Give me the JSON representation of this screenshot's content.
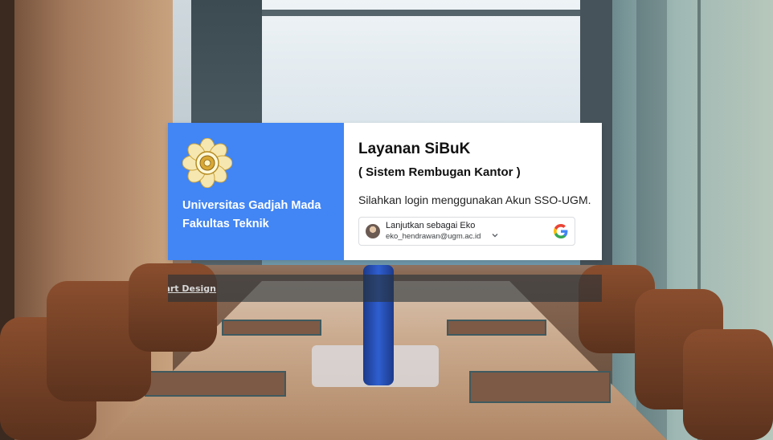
{
  "university": {
    "name_line1": "Universitas Gadjah Mada",
    "name_line2": "Fakultas Teknik",
    "logo_icon": "ugm-seal-icon"
  },
  "login": {
    "title": "Layanan SiBuK",
    "subtitle": "( Sistem Rembugan Kantor )",
    "instruction": "Silahkan login menggunakan Akun SSO-UGM."
  },
  "google_account": {
    "prompt": "Lanjutkan sebagai Eko",
    "email": "eko_hendrawan@ugm.ac.id",
    "icon": "google-g-icon"
  },
  "footer": {
    "credit_text": "art Design"
  },
  "colors": {
    "left_panel": "#4285f4",
    "card_bg": "#ffffff"
  }
}
